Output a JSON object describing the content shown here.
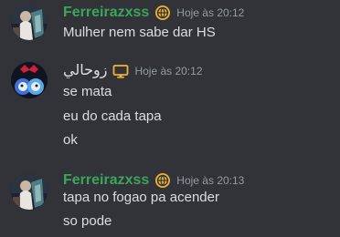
{
  "messages": [
    {
      "username": "Ferreirazxss",
      "username_color": "#3ba55c",
      "role_icon": "globe-icon",
      "timestamp": "Hoje às 20:12",
      "lines": [
        "Mulher nem sabe dar HS"
      ]
    },
    {
      "username": "زوحالي",
      "username_color": "#dbdee1",
      "role_icon": "monitor-icon",
      "timestamp": "Hoje às 20:12",
      "lines": [
        "se mata",
        "eu do cada tapa",
        "ok"
      ]
    },
    {
      "username": "Ferreirazxss",
      "username_color": "#3ba55c",
      "role_icon": "globe-icon",
      "timestamp": "Hoje às 20:13",
      "lines": [
        "tapa no fogao pa acender",
        "so pode"
      ]
    }
  ],
  "colors": {
    "background": "#313338",
    "text": "#dbdee1",
    "muted": "#949ba4",
    "globe_badge": "#f0b232",
    "monitor_badge": "#f0b232"
  }
}
